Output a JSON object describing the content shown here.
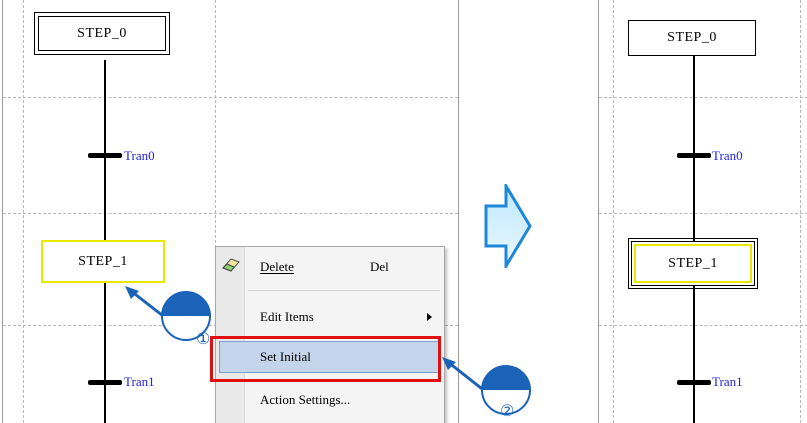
{
  "left_diagram": {
    "steps": [
      {
        "label": "STEP_0",
        "kind": "initial"
      },
      {
        "label": "STEP_1",
        "kind": "selected"
      }
    ],
    "transitions": [
      {
        "label": "Tran0"
      },
      {
        "label": "Tran1"
      }
    ]
  },
  "context_menu": {
    "items": [
      {
        "label": "Delete",
        "shortcut": "Del",
        "icon": "eraser-icon"
      },
      {
        "label": "Edit Items",
        "submenu": true
      },
      {
        "label": "Set Initial",
        "highlighted": true
      },
      {
        "label": "Action Settings..."
      }
    ]
  },
  "callouts": [
    {
      "number": "①"
    },
    {
      "number": "②"
    }
  ],
  "right_diagram": {
    "steps": [
      {
        "label": "STEP_0",
        "kind": "normal"
      },
      {
        "label": "STEP_1",
        "kind": "initial-selected"
      }
    ],
    "transitions": [
      {
        "label": "Tran0"
      },
      {
        "label": "Tran1"
      }
    ]
  },
  "colors": {
    "callout_blue": "#1b62b9",
    "highlight_red": "#e01010",
    "selection_yellow": "#e8e800",
    "transition_label_blue": "#2222dd"
  }
}
